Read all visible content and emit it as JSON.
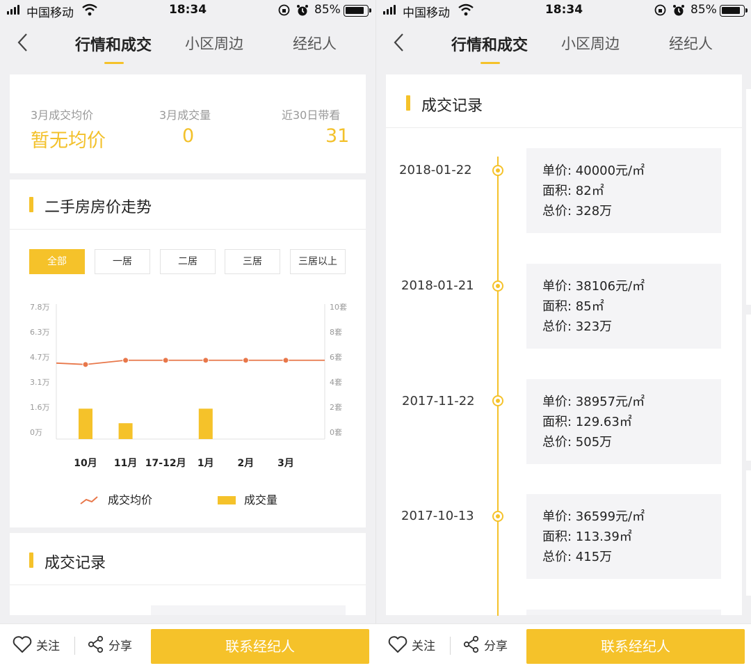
{
  "status": {
    "carrier": "中国移动",
    "time": "18:34",
    "battery": "85%"
  },
  "nav": {
    "tabs": [
      "行情和成交",
      "小区周边",
      "经纪人"
    ]
  },
  "summary": {
    "avg_price_label": "3月成交均价",
    "avg_price_value": "暂无均价",
    "deals_label": "3月成交量",
    "deals_value": "0",
    "viewings_label": "近30日带看",
    "viewings_value": "31"
  },
  "trend": {
    "title": "二手房房价走势",
    "filters": [
      "全部",
      "一居",
      "二居",
      "三居",
      "三居以上"
    ]
  },
  "chart_data": {
    "type": "bar",
    "categories": [
      "10月",
      "11月",
      "17-12月",
      "1月",
      "2月",
      "3月"
    ],
    "series": [
      {
        "name": "成交均价",
        "type": "line",
        "axis": "left",
        "values": [
          4.4,
          4.65,
          4.65,
          4.65,
          4.65,
          4.65
        ]
      },
      {
        "name": "成交量",
        "type": "bar",
        "axis": "right",
        "values": [
          2.3,
          1.2,
          0,
          2.3,
          0,
          0
        ]
      }
    ],
    "left_axis_ticks": [
      "7.8万",
      "6.3万",
      "4.7万",
      "3.1万",
      "1.6万",
      "0万"
    ],
    "right_axis_ticks": [
      "10套",
      "8套",
      "6套",
      "4套",
      "2套",
      "0套"
    ],
    "ylim_left": [
      0,
      7.8
    ],
    "ylim_right": [
      0,
      10
    ]
  },
  "records_title": "成交记录",
  "records": [
    {
      "date": "2018-01-22",
      "unit_price": "单价: 40000元/㎡",
      "area": "面积: 82㎡",
      "total": "总价: 328万"
    },
    {
      "date": "2018-01-21",
      "unit_price": "单价: 38106元/㎡",
      "area": "面积: 85㎡",
      "total": "总价: 323万"
    },
    {
      "date": "2017-11-22",
      "unit_price": "单价: 38957元/㎡",
      "area": "面积: 129.63㎡",
      "total": "总价: 505万"
    },
    {
      "date": "2017-10-13",
      "unit_price": "单价: 36599元/㎡",
      "area": "面积: 113.39㎡",
      "total": "总价: 415万"
    }
  ],
  "bottom": {
    "follow": "关注",
    "share": "分享",
    "contact": "联系经纪人"
  },
  "colors": {
    "accent": "#f5c22a",
    "price_line": "#e8774a",
    "text_value": "#f3c12b"
  }
}
